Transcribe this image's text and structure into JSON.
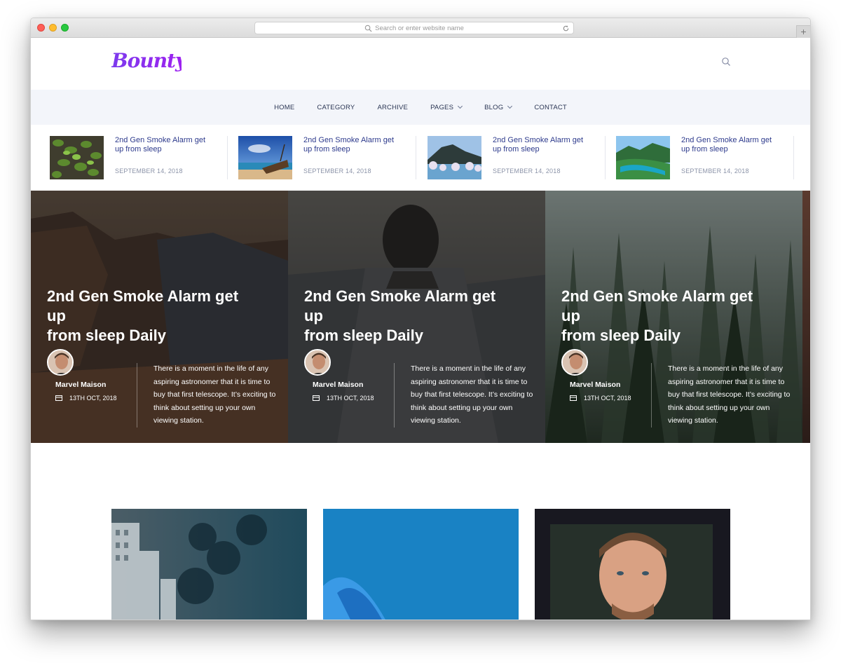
{
  "browser": {
    "url_placeholder": "Search or enter website name",
    "newtab_label": "+"
  },
  "header": {
    "logo_text": "Bounty",
    "logo_color": "#8a2be2"
  },
  "nav": {
    "items": [
      {
        "label": "HOME",
        "dropdown": false
      },
      {
        "label": "CATEGORY",
        "dropdown": false
      },
      {
        "label": "ARCHIVE",
        "dropdown": false
      },
      {
        "label": "PAGES",
        "dropdown": true
      },
      {
        "label": "BLOG",
        "dropdown": true
      },
      {
        "label": "CONTACT",
        "dropdown": false
      }
    ]
  },
  "strip": {
    "items": [
      {
        "title": "2nd Gen Smoke Alarm get up from sleep",
        "date": "SEPTEMBER 14, 2018",
        "thumb": "leaves"
      },
      {
        "title": "2nd Gen Smoke Alarm get up from sleep",
        "date": "SEPTEMBER 14, 2018",
        "thumb": "boat"
      },
      {
        "title": "2nd Gen Smoke Alarm get up from sleep",
        "date": "SEPTEMBER 14, 2018",
        "thumb": "lake"
      },
      {
        "title": "2nd Gen Smoke Alarm get up from sleep",
        "date": "SEPTEMBER 14, 2018",
        "thumb": "river"
      }
    ]
  },
  "hero": {
    "cards": [
      {
        "title_line1": "2nd Gen Smoke Alarm get",
        "title_line2": "up",
        "title_line3": "from sleep Daily",
        "author": "Marvel Maison",
        "date": "13TH OCT, 2018",
        "excerpt": "There is a moment in the life of any aspiring astronomer that it is time to buy that first telescope. It’s exciting to think about setting up your own viewing station.",
        "bg": "canyon"
      },
      {
        "title_line1": "2nd Gen Smoke Alarm get",
        "title_line2": "up",
        "title_line3": "from sleep Daily",
        "author": "Marvel Maison",
        "date": "13TH OCT, 2018",
        "excerpt": "There is a moment in the life of any aspiring astronomer that it is time to buy that first telescope. It’s exciting to think about setting up your own viewing station.",
        "bg": "person"
      },
      {
        "title_line1": "2nd Gen Smoke Alarm get",
        "title_line2": "up",
        "title_line3": "from sleep Daily",
        "author": "Marvel Maison",
        "date": "13TH OCT, 2018",
        "excerpt": "There is a moment in the life of any aspiring astronomer that it is time to buy that first telescope. It’s exciting to think about setting up your own viewing station.",
        "bg": "forest"
      }
    ]
  },
  "cards": [
    {
      "image": "city-storm"
    },
    {
      "image": "ocean"
    },
    {
      "image": "portrait"
    }
  ]
}
